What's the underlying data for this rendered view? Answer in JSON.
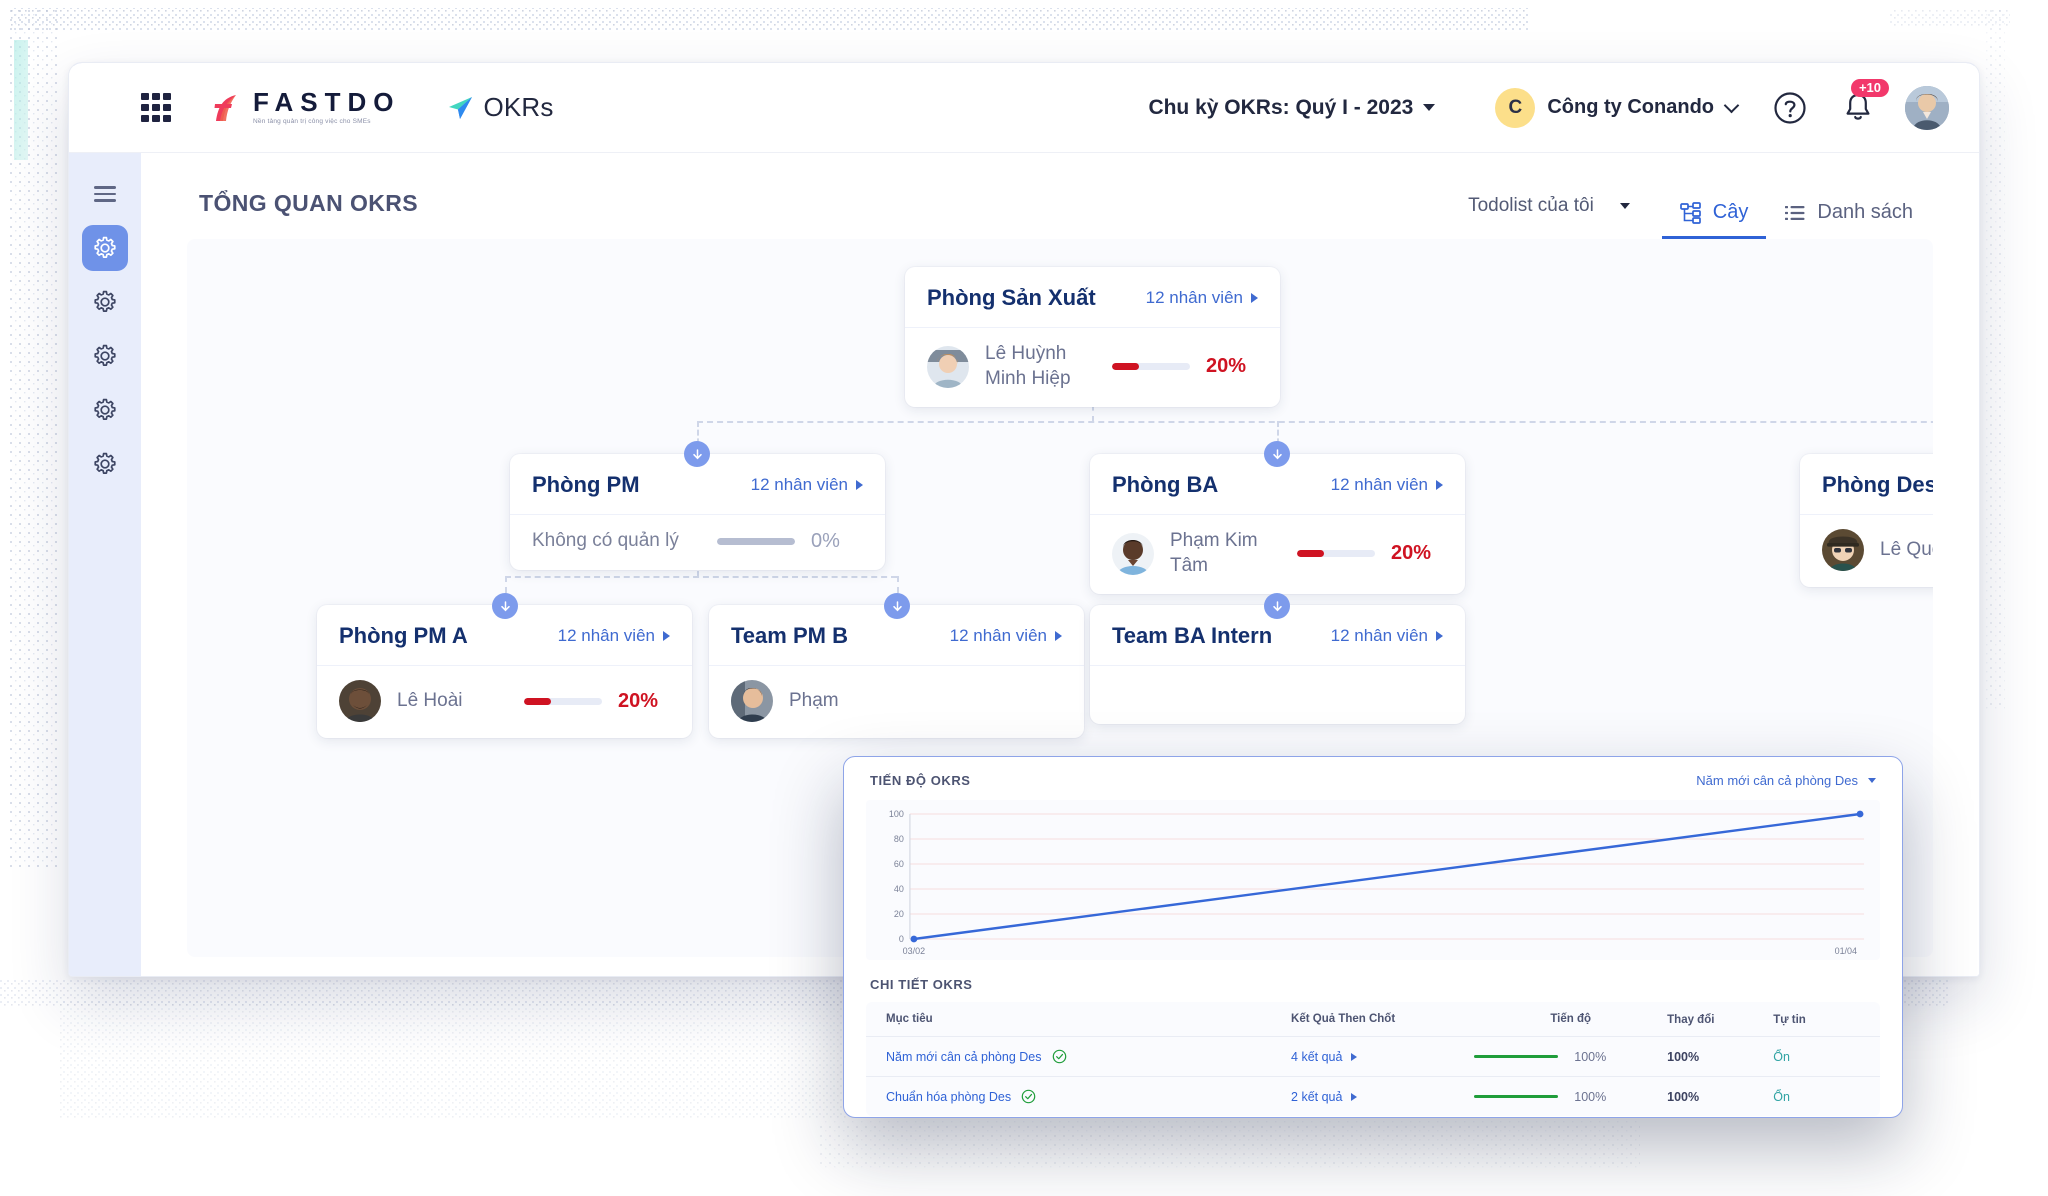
{
  "topbar": {
    "grid_icon": "apps-grid-icon",
    "brand_name": "FASTDO",
    "brand_tagline": "Nền tảng quản trị công việc cho SMEs",
    "product_name": "OKRs",
    "cycle_label": "Chu kỳ OKRs: Quý I - 2023",
    "company_initial": "C",
    "company_name": "Công ty Conando",
    "help_icon": "help-circle-icon",
    "bell_icon": "bell-icon",
    "notification_badge": "+10",
    "avatar_icon": "user-avatar"
  },
  "sidebar": {
    "menu_icon": "hamburger-menu-icon",
    "items": [
      {
        "icon": "gear-icon",
        "active": true
      },
      {
        "icon": "gear-icon",
        "active": false
      },
      {
        "icon": "gear-icon",
        "active": false
      },
      {
        "icon": "gear-icon",
        "active": false
      },
      {
        "icon": "gear-icon",
        "active": false
      }
    ]
  },
  "content": {
    "page_title": "TỔNG QUAN OKRS",
    "todolist_label": "Todolist của tôi",
    "tabs": [
      {
        "label": "Cây",
        "icon": "org-tree-icon",
        "active": true
      },
      {
        "label": "Danh sách",
        "icon": "list-icon",
        "active": false
      }
    ]
  },
  "tree": {
    "nodes": [
      {
        "id": "san-xuat",
        "title": "Phòng Sản Xuất",
        "count_label": "12 nhân viên",
        "person": "Lê Huỳnh Minh Hiệp",
        "progress_label": "20%",
        "progress_value": 20
      },
      {
        "id": "pm",
        "title": "Phòng PM",
        "count_label": "12 nhân viên",
        "person": "Không có quản lý",
        "progress_label": "0%",
        "progress_value": 0
      },
      {
        "id": "ba",
        "title": "Phòng BA",
        "count_label": "12 nhân viên",
        "person": "Phạm Kim Tâm",
        "progress_label": "20%",
        "progress_value": 20
      },
      {
        "id": "design",
        "title": "Phòng Design",
        "count_label": "",
        "person": "Lê Quốc Việt",
        "progress_label": "",
        "progress_value": null
      },
      {
        "id": "pm-a",
        "title": "Phòng PM A",
        "count_label": "12 nhân viên",
        "person": "Lê Hoài",
        "progress_label": "20%",
        "progress_value": 20
      },
      {
        "id": "pm-b",
        "title": "Team PM B",
        "count_label": "12 nhân viên",
        "person": "Phạm",
        "progress_label": "",
        "progress_value": null
      },
      {
        "id": "ba-intern",
        "title": "Team BA Intern",
        "count_label": "12 nhân viên",
        "person": "",
        "progress_label": "",
        "progress_value": null
      }
    ]
  },
  "popup": {
    "chart_caption": "TIẾN ĐỘ OKRS",
    "filter_label": "Năm mới cân cả phòng Des",
    "table_caption": "CHI TIẾT OKRS",
    "columns": [
      "Mục tiêu",
      "Kết Quả Then Chốt",
      "Tiến độ",
      "Thay đổi",
      "Tự tin"
    ],
    "rows": [
      {
        "objective": "Năm mới cân cả phòng Des",
        "status_icon": "check-circle-icon",
        "key_results": "4 kết quả",
        "progress_label": "100%",
        "progress_value": 100,
        "change": "100%",
        "confidence": "Ổn"
      },
      {
        "objective": "Chuẩn hóa phòng Des",
        "status_icon": "check-circle-icon",
        "key_results": "2 kết quả",
        "progress_label": "100%",
        "progress_value": 100,
        "change": "100%",
        "confidence": "Ổn"
      }
    ]
  },
  "chart_data": {
    "type": "line",
    "title": "TIẾN ĐỘ OKRS",
    "xlabel": "",
    "ylabel": "",
    "x": [
      "03/02",
      "01/04"
    ],
    "values": [
      0,
      100
    ],
    "ylim": [
      0,
      100
    ],
    "yticks": [
      0,
      20,
      40,
      60,
      80,
      100
    ],
    "xticks": [
      "03/02",
      "01/04"
    ],
    "grid": true,
    "legend": false,
    "series": [
      {
        "name": "Tiến độ OKRs",
        "values": [
          0,
          100
        ],
        "color": "#3668d8"
      }
    ],
    "gridline_color": "#f7dede"
  },
  "colors": {
    "accent": "#2f62d6",
    "danger": "#cf1322",
    "success": "#1f9d3a",
    "node_title": "#14306e",
    "sidebar_bg": "#e8edfb",
    "badge": "#f2386b"
  }
}
